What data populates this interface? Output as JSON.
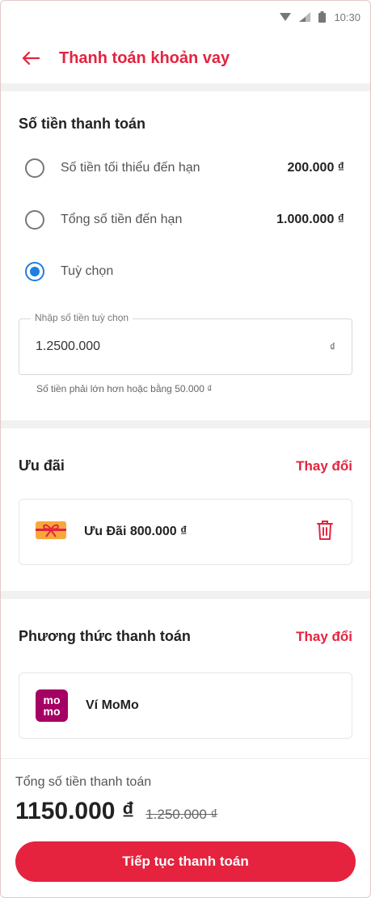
{
  "status_bar": {
    "time": "10:30"
  },
  "header": {
    "title": "Thanh toán khoản vay"
  },
  "payment_amount": {
    "title": "Số tiền thanh toán",
    "options": [
      {
        "label": "Số tiền tối thiểu đến hạn",
        "amount": "200.000 ₫",
        "selected": false
      },
      {
        "label": "Tổng số tiền đến hạn",
        "amount": "1.000.000 ₫",
        "selected": false
      },
      {
        "label": "Tuỳ chọn",
        "amount": "",
        "selected": true
      }
    ],
    "custom_field": {
      "legend": "Nhập số tiền tuỳ chọn",
      "value": "1.2500.000",
      "unit": "₫",
      "hint": "Số tiền phải lớn hơn hoặc bằng 50.000 ₫"
    }
  },
  "promotion": {
    "title": "Ưu đãi",
    "change_label": "Thay đổi",
    "item_label": "Ưu Đãi 800.000 ₫",
    "icon": "gift-voucher-icon"
  },
  "payment_method": {
    "title": "Phương thức thanh toán",
    "change_label": "Thay đổi",
    "item_label": "Ví MoMo",
    "logo_text_top": "mo",
    "logo_text_bottom": "mo"
  },
  "summary": {
    "label": "Tổng số tiền thanh toán",
    "total": "1150.000 ₫",
    "original": "1.250.000 ₫"
  },
  "cta": {
    "label": "Tiếp tục thanh toán"
  },
  "colors": {
    "primary": "#e5233f",
    "radio_active": "#1e7fe0",
    "momo": "#a50064"
  }
}
